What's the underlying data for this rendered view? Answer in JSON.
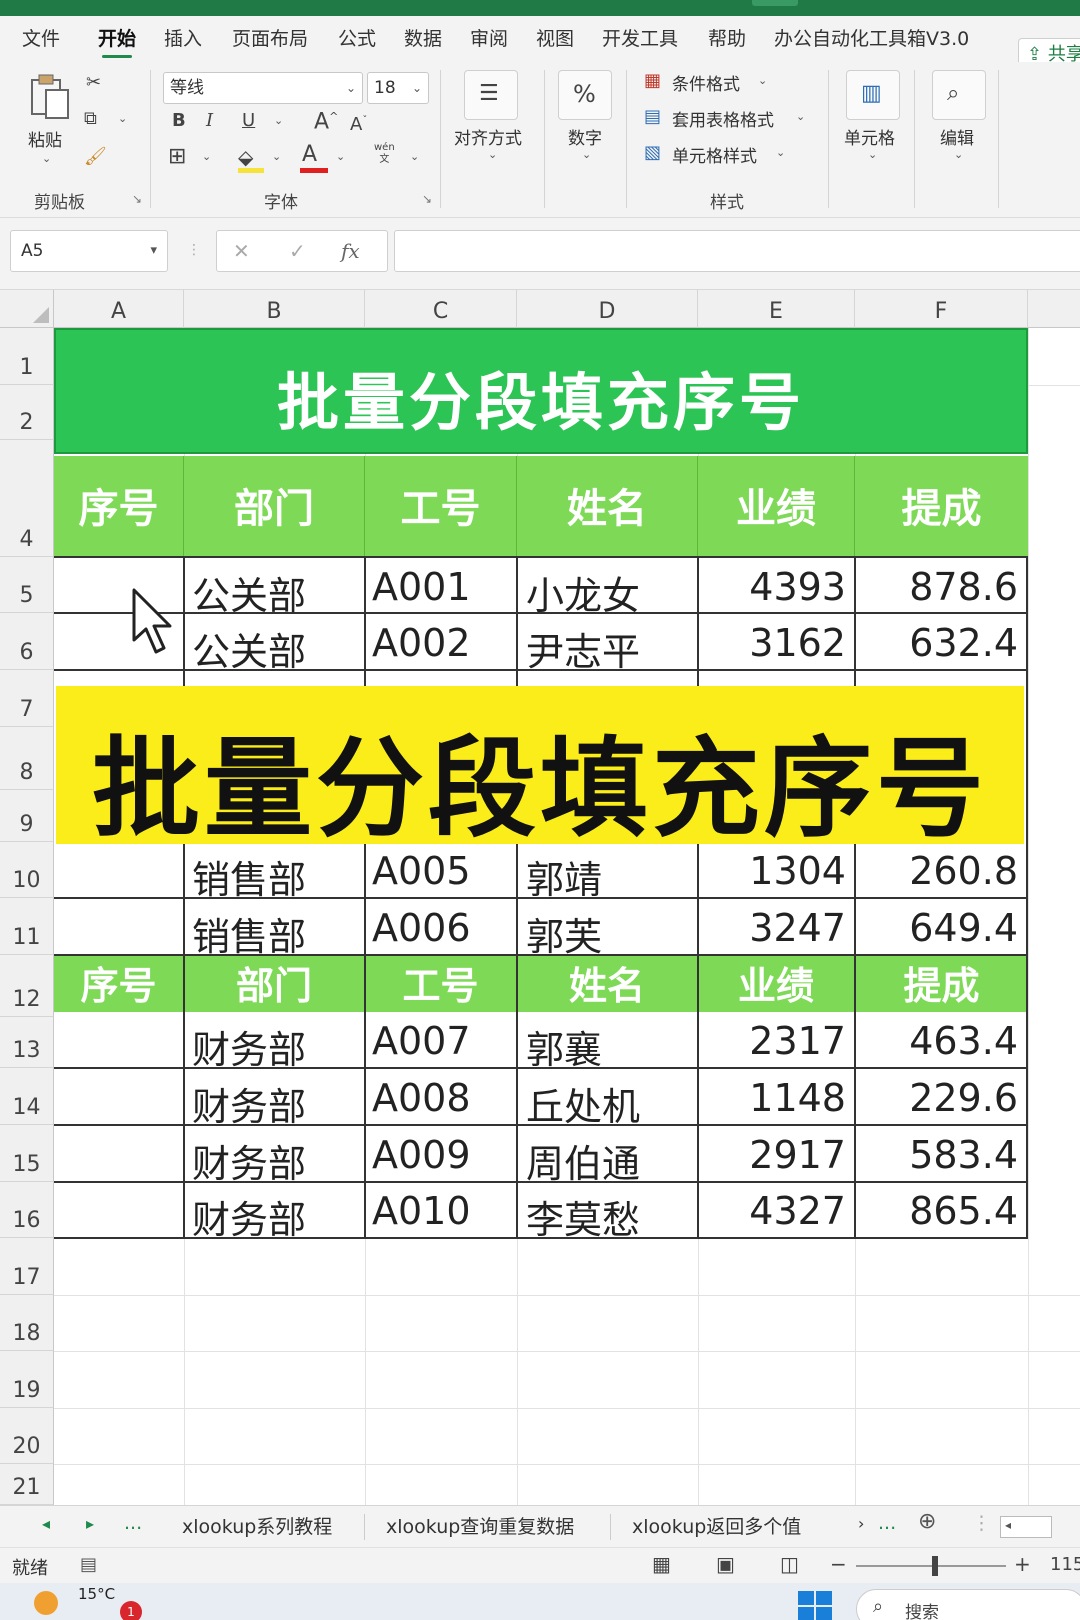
{
  "ribbon_tabs": [
    "文件",
    "开始",
    "插入",
    "页面布局",
    "公式",
    "数据",
    "审阅",
    "视图",
    "开发工具",
    "帮助",
    "办公自动化工具箱V3.0"
  ],
  "active_tab": "开始",
  "share_label": "共享",
  "clipboard": {
    "paste_label": "粘贴",
    "group_label": "剪贴板"
  },
  "font": {
    "name": "等线",
    "size": "18",
    "group_label": "字体",
    "bold": "B",
    "italic": "I",
    "underline": "U",
    "wen": "wén"
  },
  "alignment": {
    "label": "对齐方式"
  },
  "number": {
    "label": "数字"
  },
  "styles": {
    "conditional": "条件格式",
    "table_format": "套用表格格式",
    "cell_styles": "单元格样式",
    "group_label": "样式"
  },
  "cells": {
    "label": "单元格"
  },
  "editing": {
    "label": "编辑"
  },
  "formula_bar": {
    "name_box": "A5",
    "fx": "fx",
    "cancel": "✕",
    "enter": "✓",
    "content": ""
  },
  "columns": [
    "A",
    "B",
    "C",
    "D",
    "E",
    "F"
  ],
  "rows": [
    "1",
    "2",
    "4",
    "5",
    "6",
    "7",
    "8",
    "9",
    "10",
    "11",
    "12",
    "13",
    "14",
    "15",
    "16",
    "17",
    "18",
    "19",
    "20",
    "21"
  ],
  "sheet_title": "批量分段填充序号",
  "header_labels": [
    "序号",
    "部门",
    "工号",
    "姓名",
    "业绩",
    "提成"
  ],
  "table_rows": [
    {
      "seq": "",
      "dept": "公关部",
      "id": "A001",
      "name": "小龙女",
      "sales": "4393",
      "commission": "878.6"
    },
    {
      "seq": "",
      "dept": "公关部",
      "id": "A002",
      "name": "尹志平",
      "sales": "3162",
      "commission": "632.4"
    },
    {
      "seq": "",
      "dept": "销售部",
      "id": "A005",
      "name": "郭靖",
      "sales": "1304",
      "commission": "260.8"
    },
    {
      "seq": "",
      "dept": "销售部",
      "id": "A006",
      "name": "郭芙",
      "sales": "3247",
      "commission": "649.4"
    },
    {
      "seq": "",
      "dept": "财务部",
      "id": "A007",
      "name": "郭襄",
      "sales": "2317",
      "commission": "463.4"
    },
    {
      "seq": "",
      "dept": "财务部",
      "id": "A008",
      "name": "丘处机",
      "sales": "1148",
      "commission": "229.6"
    },
    {
      "seq": "",
      "dept": "财务部",
      "id": "A009",
      "name": "周伯通",
      "sales": "2917",
      "commission": "583.4"
    },
    {
      "seq": "",
      "dept": "财务部",
      "id": "A010",
      "name": "李莫愁",
      "sales": "4327",
      "commission": "865.4"
    }
  ],
  "overlay_banner": "批量分段填充序号",
  "sheet_tabs": [
    "xlookup系列教程",
    "xlookup查询重复数据",
    "xlookup返回多个值"
  ],
  "sheet_tabs_more": "...",
  "status": {
    "ready": "就绪",
    "zoom": "115"
  },
  "taskbar": {
    "weather": "15°C",
    "notify_count": "1",
    "search": "搜索"
  },
  "colors": {
    "title_green": "#2cc455",
    "header_green": "#7ed957",
    "banner_yellow": "#fbed1a",
    "excel_green": "#1e8a4c"
  }
}
